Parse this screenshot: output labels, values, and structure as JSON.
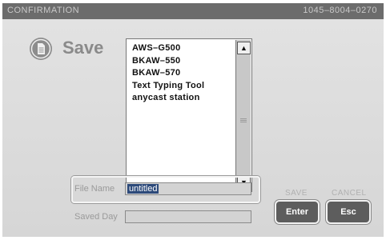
{
  "title_bar": {
    "title": "CONFIRMATION",
    "code": "1045–8004–0270"
  },
  "heading": {
    "label": "Save",
    "icon": "document-icon"
  },
  "file_list": {
    "items": [
      "AWS–G500",
      "BKAW–550",
      "BKAW–570",
      "Text Typing Tool",
      "anycast station"
    ],
    "scroll_up": "▲",
    "scroll_down": "▼"
  },
  "form": {
    "file_name_label": "File Name",
    "file_name_value": "untitled",
    "saved_day_label": "Saved Day",
    "saved_day_value": ""
  },
  "buttons": {
    "save_caption": "SAVE",
    "enter_label": "Enter",
    "cancel_caption": "CANCEL",
    "esc_label": "Esc"
  }
}
